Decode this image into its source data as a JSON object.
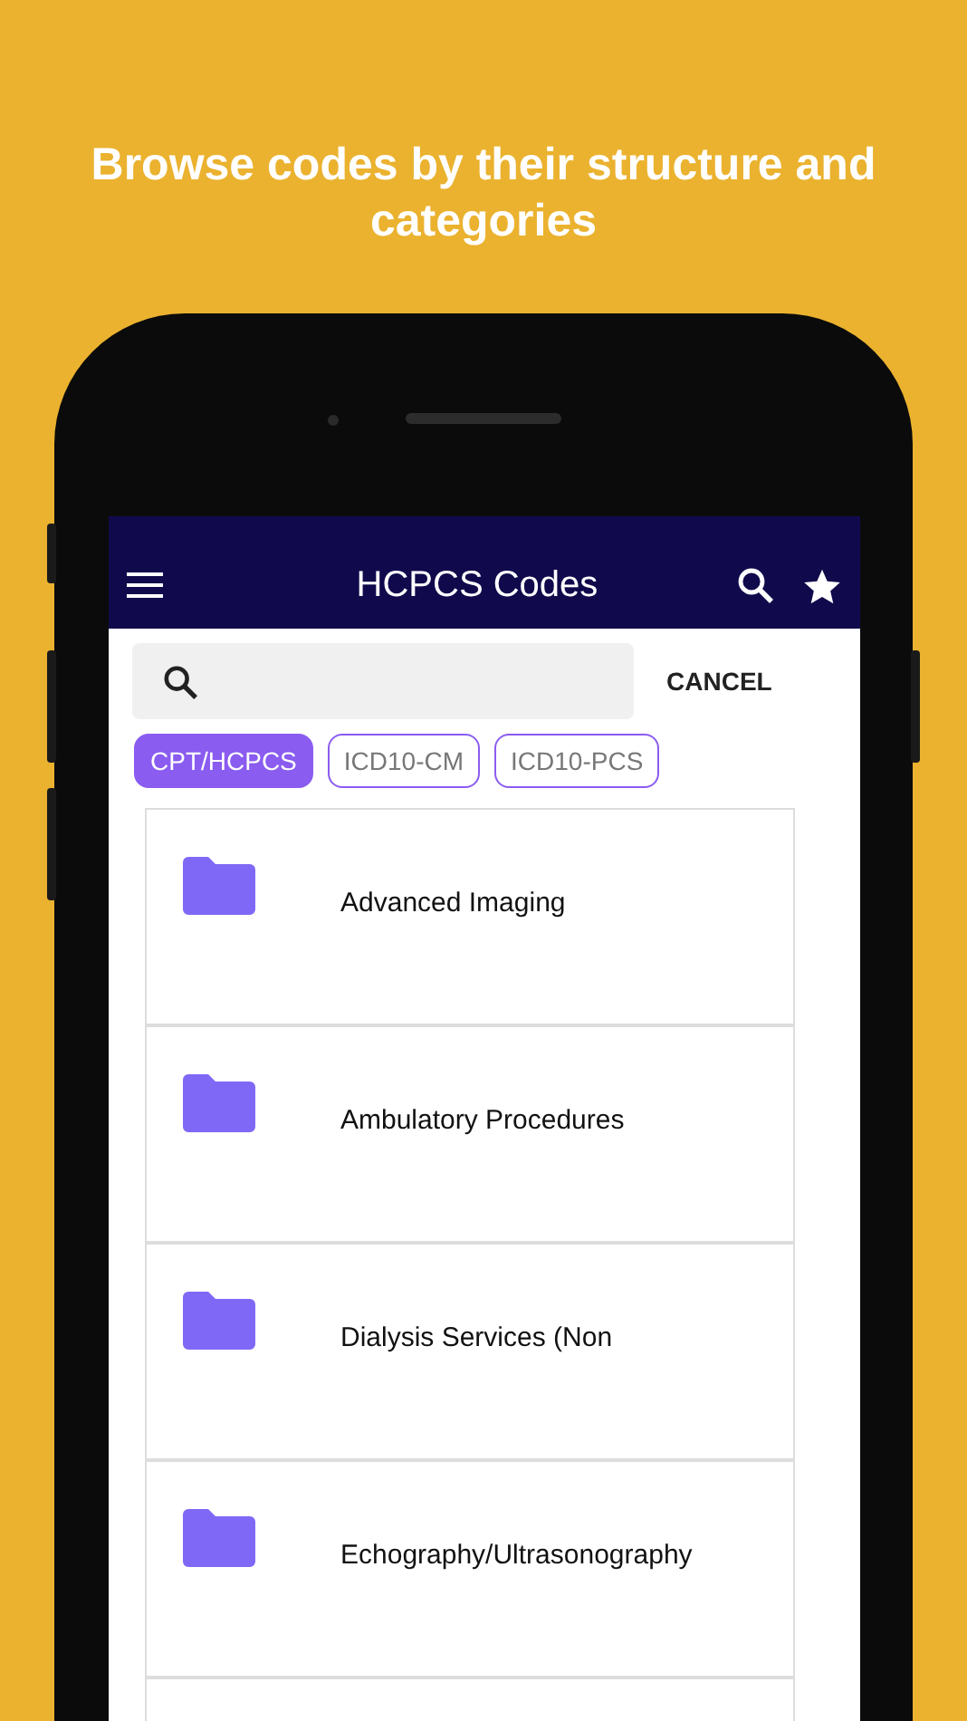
{
  "headline": "Browse codes by their structure and categories",
  "app_bar": {
    "title": "HCPCS Codes"
  },
  "search": {
    "action": "CANCEL"
  },
  "chips": [
    {
      "label": "CPT/HCPCS",
      "selected": true
    },
    {
      "label": "ICD10-CM",
      "selected": false
    },
    {
      "label": "ICD10-PCS",
      "selected": false
    }
  ],
  "categories": [
    {
      "name": "Advanced Imaging"
    },
    {
      "name": "Ambulatory Procedures"
    },
    {
      "name": "Dialysis Services (Non"
    },
    {
      "name": "Echography/Ultrasonography"
    }
  ]
}
